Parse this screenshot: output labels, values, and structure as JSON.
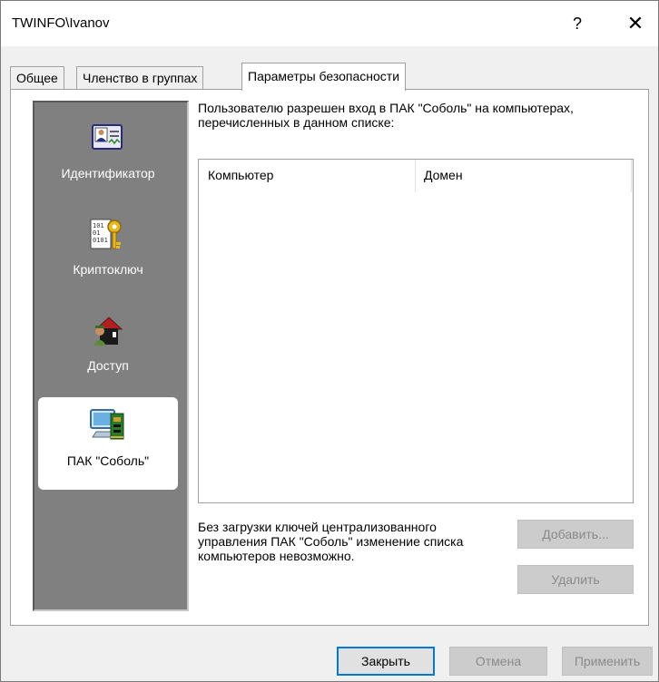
{
  "window": {
    "title": "TWINFO\\Ivanov",
    "help_label": "?",
    "close_label": "✕"
  },
  "tabs": [
    {
      "label": "Общее"
    },
    {
      "label": "Членство в группах"
    },
    {
      "label": "Параметры безопасности",
      "active": true
    }
  ],
  "side_panel": {
    "items": [
      {
        "label": "Идентификатор",
        "icon": "id-card-icon"
      },
      {
        "label": "Криптоключ",
        "icon": "binary-key-icon"
      },
      {
        "label": "Доступ",
        "icon": "house-access-icon"
      },
      {
        "label": "ПАК \"Соболь\"",
        "icon": "computer-board-icon",
        "selected": true
      }
    ]
  },
  "content": {
    "description": "Пользователю разрешен вход в ПАК \"Соболь\" на компьютерах, перечисленных в данном списке:",
    "list_columns": [
      "Компьютер",
      "Домен"
    ],
    "rows": [],
    "note": "Без загрузки ключей централизованного управления ПАК \"Соболь\" изменение списка компьютеров невозможно.",
    "add_label": "Добавить...",
    "delete_label": "Удалить"
  },
  "footer": {
    "close_label": "Закрыть",
    "cancel_label": "Отмена",
    "apply_label": "Применить"
  },
  "colors": {
    "accent": "#0078d7",
    "panel_bg": "#808080"
  }
}
